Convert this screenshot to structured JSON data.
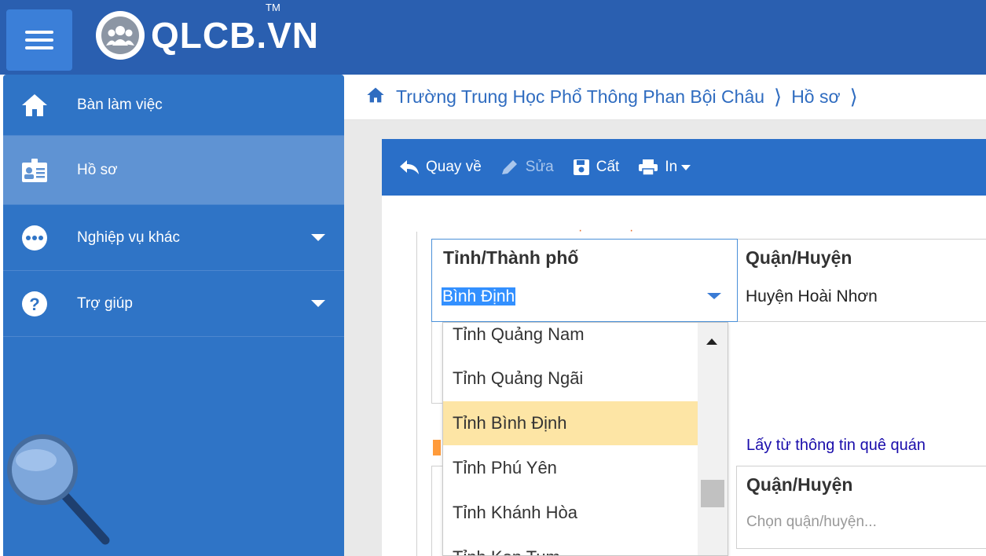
{
  "header": {
    "logo_text": "QLCB.VN",
    "logo_tm": "TM"
  },
  "sidebar": {
    "items": [
      {
        "label": "Bàn làm việc",
        "icon": "home-icon"
      },
      {
        "label": "Hồ sơ",
        "icon": "id-card-icon"
      },
      {
        "label": "Nghiệp vụ khác",
        "icon": "more-icon"
      },
      {
        "label": "Trợ giúp",
        "icon": "help-icon"
      }
    ]
  },
  "breadcrumb": {
    "school": "Trường Trung Học Phổ Thông Phan Bội Châu",
    "section": "Hồ sơ",
    "separator": "⟩"
  },
  "toolbar": {
    "back_label": "Quay về",
    "edit_label": "Sửa",
    "save_label": "Cất",
    "print_label": "In"
  },
  "form": {
    "province_label": "Tỉnh/Thành phố",
    "province_value": "Bình Định",
    "district_label": "Quận/Huyện",
    "district_value": "Huyện Hoài Nhơn",
    "link_text": "Lấy từ thông tin quê quán",
    "district2_label": "Quận/Huyện",
    "district2_placeholder": "Chọn quận/huyện..."
  },
  "dropdown": {
    "options": [
      "Tỉnh Quảng Nam",
      "Tỉnh Quảng Ngãi",
      "Tỉnh Bình Định",
      "Tỉnh Phú Yên",
      "Tỉnh Khánh Hòa",
      "Tỉnh Kon Tum"
    ],
    "highlighted": "Tỉnh Bình Định"
  },
  "colors": {
    "topbar": "#2a5fb0",
    "sidebar": "#2f74c6",
    "sidebar_active": "#5f93d3",
    "toolbar": "#2a6fc8",
    "highlight": "#fde5a5"
  }
}
